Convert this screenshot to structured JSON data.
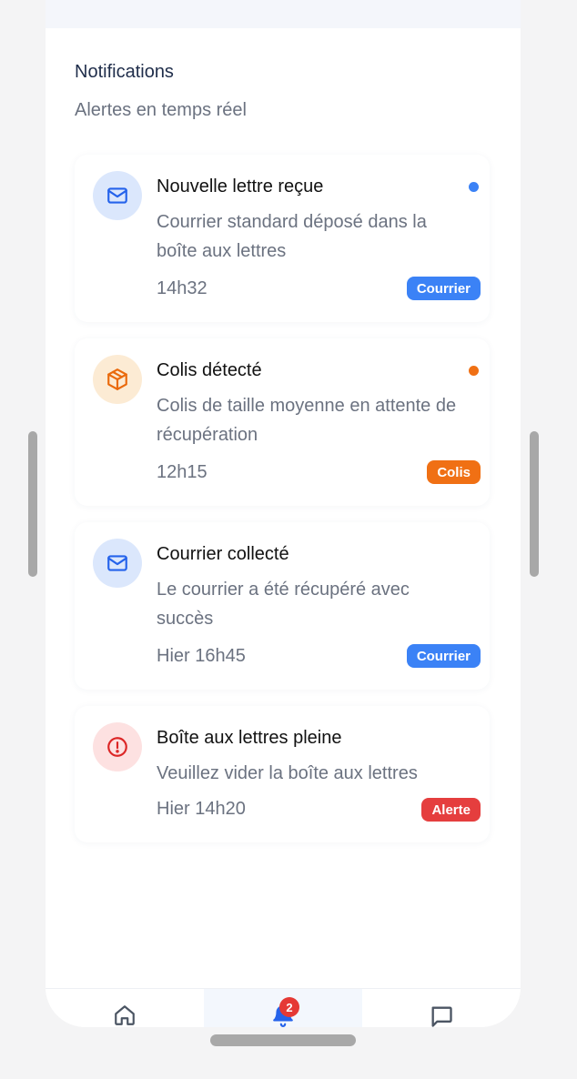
{
  "header": {
    "title": "Notifications",
    "subtitle": "Alertes en temps réel"
  },
  "notifications": [
    {
      "icon": "mail-icon",
      "title": "Nouvelle lettre reçue",
      "description": "Courrier standard déposé dans la boîte aux lettres",
      "time": "14h32",
      "badge": "Courrier",
      "badge_color": "#3b82f6",
      "unread": true,
      "dot_color": "#3b82f6"
    },
    {
      "icon": "package-icon",
      "title": "Colis détecté",
      "description": "Colis de taille moyenne en attente de récupération",
      "time": "12h15",
      "badge": "Colis",
      "badge_color": "#f07014",
      "unread": true,
      "dot_color": "#f07014"
    },
    {
      "icon": "mail-icon",
      "title": "Courrier collecté",
      "description": "Le courrier a été récupéré avec succès",
      "time": "Hier 16h45",
      "badge": "Courrier",
      "badge_color": "#3b82f6",
      "unread": false
    },
    {
      "icon": "alert-circle-icon",
      "title": "Boîte aux lettres pleine",
      "description": "Veuillez vider la boîte aux lettres",
      "time": "Hier 14h20",
      "badge": "Alerte",
      "badge_color": "#e53e3e",
      "unread": false
    }
  ],
  "nav": {
    "items": [
      {
        "icon": "home-icon",
        "active": false
      },
      {
        "icon": "bell-icon",
        "active": true,
        "badge_count": "2"
      },
      {
        "icon": "message-icon",
        "active": false
      }
    ]
  },
  "colors": {
    "accent": "#3b82f6",
    "orange": "#f07014",
    "danger": "#e53e3e"
  }
}
